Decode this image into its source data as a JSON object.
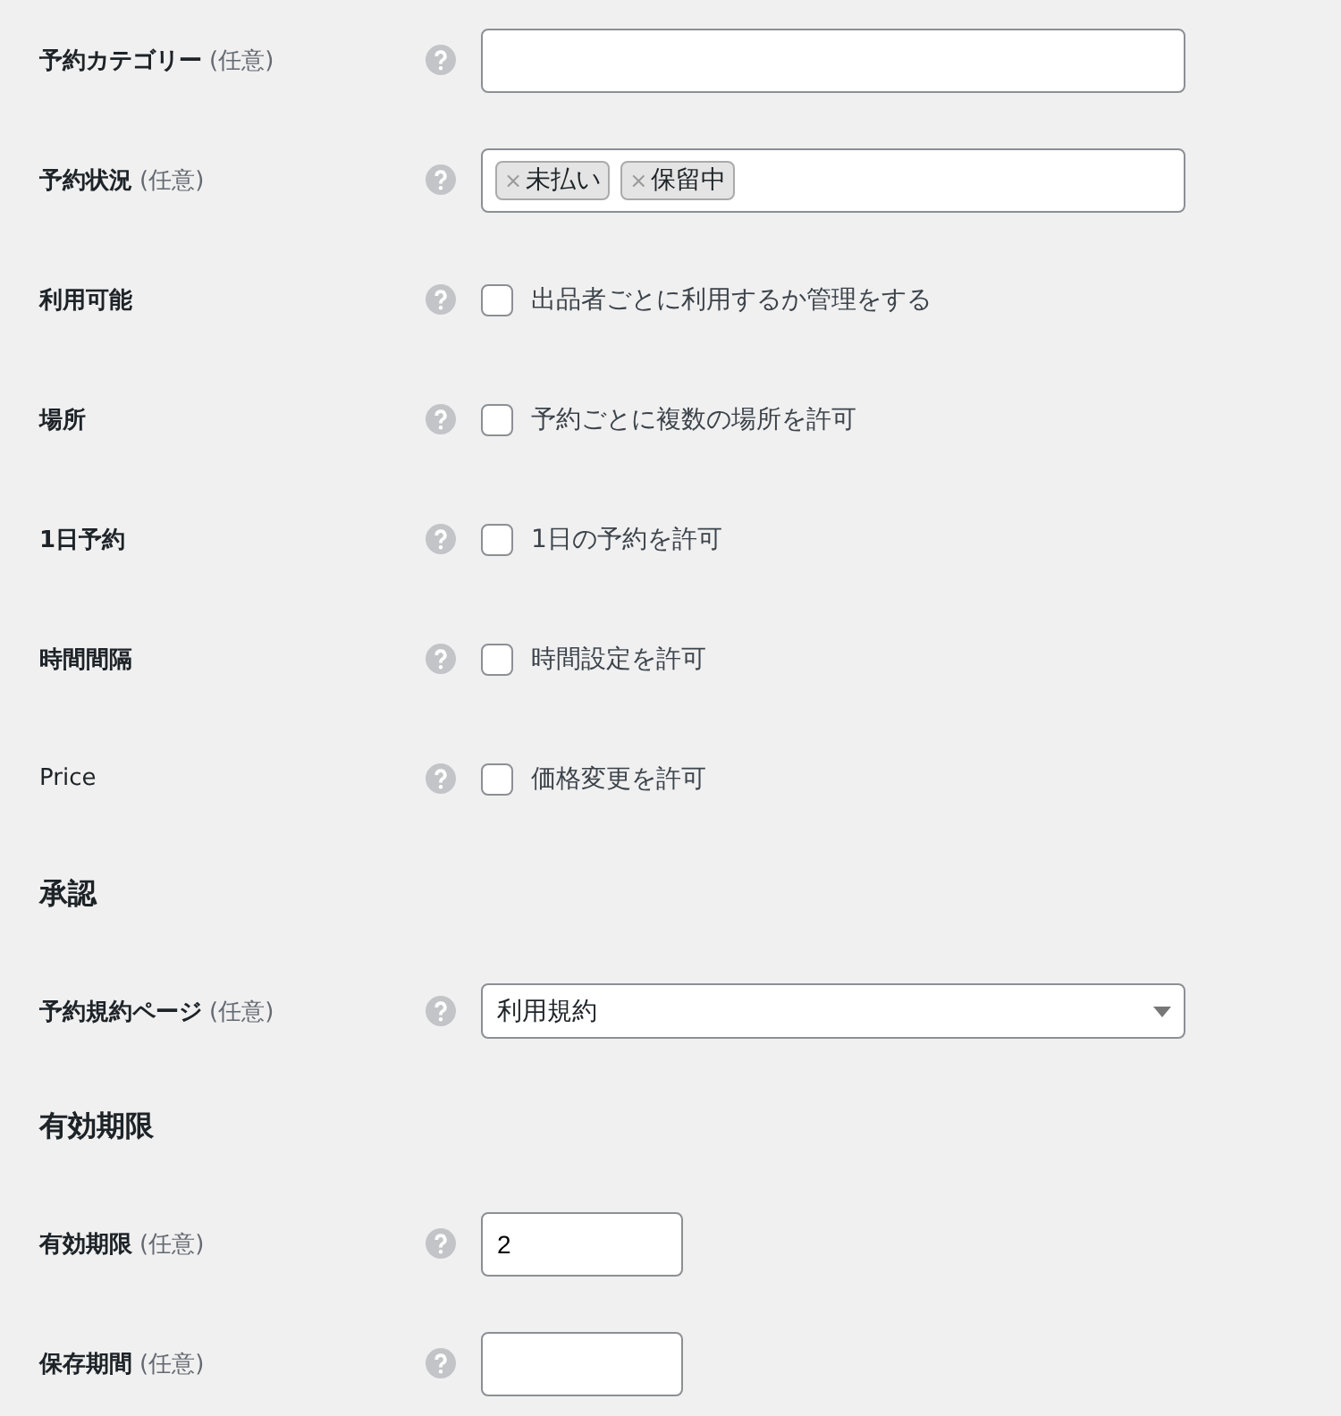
{
  "rows": [
    {
      "kind": "text",
      "label": "予約カテゴリー",
      "bold": true,
      "optional": "(任意)",
      "value": ""
    },
    {
      "kind": "tags",
      "label": "予約状況",
      "bold": true,
      "optional": "(任意)",
      "tags": [
        {
          "remove": "×",
          "text": "未払い"
        },
        {
          "remove": "×",
          "text": "保留中"
        }
      ]
    },
    {
      "kind": "checkbox",
      "label": "利用可能",
      "bold": true,
      "option": "出品者ごとに利用するか管理をする",
      "checked": false
    },
    {
      "kind": "checkbox",
      "label": "場所",
      "bold": true,
      "option": "予約ごとに複数の場所を許可",
      "checked": false
    },
    {
      "kind": "checkbox",
      "label": "1日予約",
      "bold": true,
      "option": "1日の予約を許可",
      "checked": false
    },
    {
      "kind": "checkbox",
      "label": "時間間隔",
      "bold": true,
      "option": "時間設定を許可",
      "checked": false
    },
    {
      "kind": "checkbox",
      "label": "Price",
      "bold": false,
      "option": "価格変更を許可",
      "checked": false
    },
    {
      "kind": "heading",
      "label": "承認"
    },
    {
      "kind": "select",
      "label": "予約規約ページ",
      "bold": true,
      "optional": "(任意)",
      "value": "利用規約"
    },
    {
      "kind": "heading",
      "label": "有効期限"
    },
    {
      "kind": "number",
      "label": "有効期限",
      "bold": true,
      "optional": "(任意)",
      "value": "2"
    },
    {
      "kind": "number",
      "label": "保存期間",
      "bold": true,
      "optional": "(任意)",
      "value": ""
    }
  ]
}
